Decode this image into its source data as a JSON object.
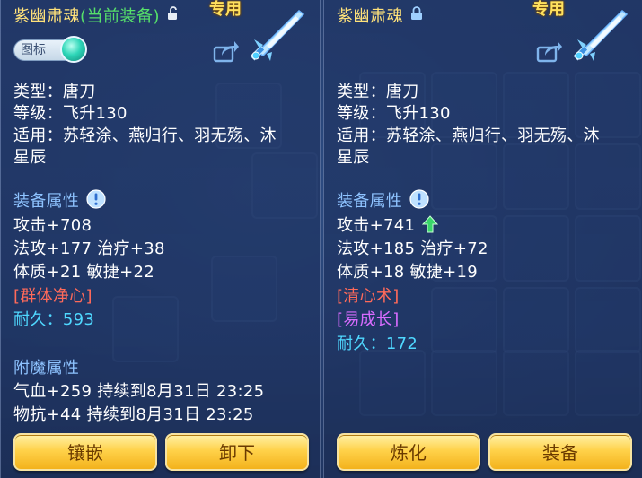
{
  "left_panel": {
    "title_name": "紫幽肃魂",
    "title_status": "(当前装备)",
    "badge": "专用",
    "toggle_label": "图标",
    "type": "类型：唐刀",
    "level": "等级：飞升130",
    "applicable_1": "适用：苏轻涂、燕归行、羽无殇、沐",
    "applicable_2": "星辰",
    "attr_header": "装备属性",
    "attack": "攻击+708",
    "magic_heal": "法攻+177 治疗+38",
    "con_agi": "体质+21 敏捷+22",
    "skill_1": "[群体净心]",
    "durability_label": "耐久：",
    "durability_value": "593",
    "enchant_header": "附魔属性",
    "enchant_1": "气血+259 持续到8月31日 23:25",
    "enchant_2": "物抗+44 持续到8月31日 23:25",
    "button_1": "镶嵌",
    "button_2": "卸下"
  },
  "right_panel": {
    "title_name": "紫幽肃魂",
    "badge": "专用",
    "type": "类型：唐刀",
    "level": "等级：飞升130",
    "applicable_1": "适用：苏轻涂、燕归行、羽无殇、沐",
    "applicable_2": "星辰",
    "attr_header": "装备属性",
    "attack": "攻击+741",
    "magic_heal": "法攻+185 治疗+72",
    "con_agi": "体质+18 敏捷+19",
    "skill_1": "[清心术]",
    "skill_2": "[易成长]",
    "durability_label": "耐久：",
    "durability_value": "172",
    "button_1": "炼化",
    "button_2": "装备"
  },
  "colors": {
    "title": "#ffe27a",
    "equipped_status": "#56e06a",
    "section_header": "#8ec3ff",
    "skill_red": "#ff6a5a",
    "skill_purple": "#d86cff",
    "durability": "#4fd8ff",
    "button": "#ffd24a"
  },
  "icons": {
    "lock_open": "unlock-icon",
    "lock_closed": "lock-icon",
    "share": "share-icon",
    "info": "info-icon",
    "up": "up-arrow-icon",
    "weapon": "weapon-icon"
  }
}
